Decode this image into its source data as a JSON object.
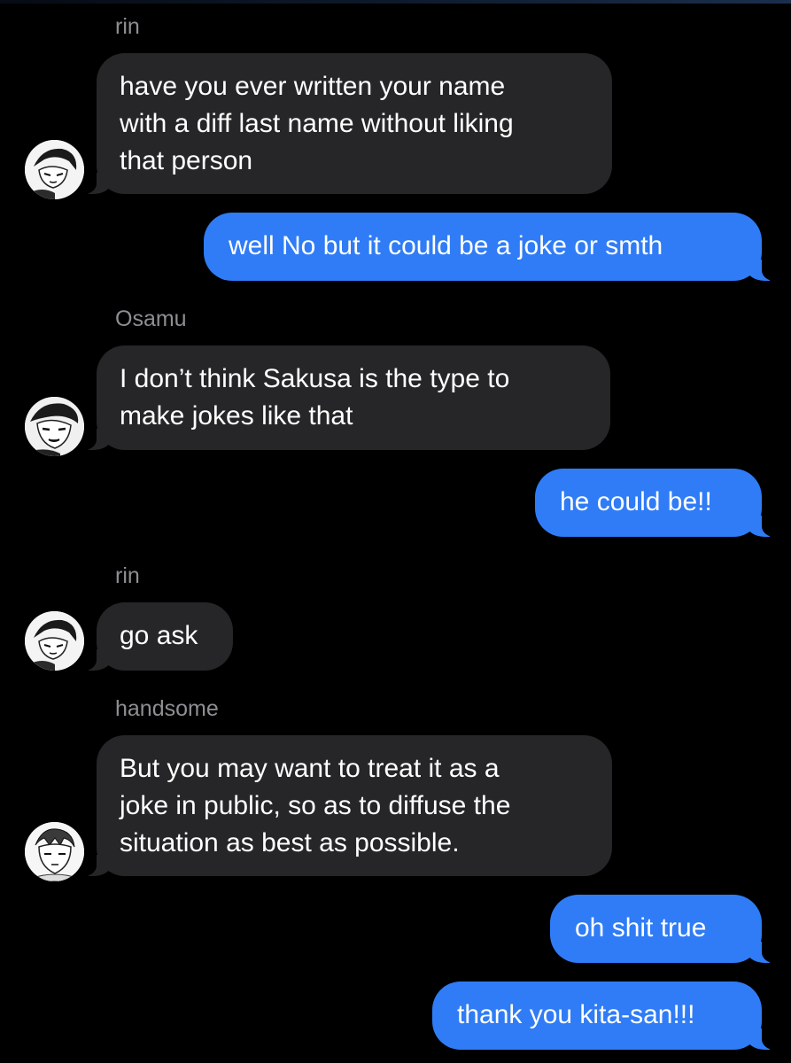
{
  "conversation": {
    "messages": [
      {
        "sender": "rin",
        "lines": [
          "have you ever written your name",
          "with a diff last name without liking",
          "that person"
        ],
        "avatar": "rin-avatar"
      },
      {
        "text": "well No but it could be a joke or smth"
      },
      {
        "sender": "Osamu",
        "lines": [
          "I don’t think Sakusa is the type to",
          "make jokes like that"
        ],
        "avatar": "osamu-avatar"
      },
      {
        "text": "he could be!!"
      },
      {
        "sender": "rin",
        "lines": [
          "go ask"
        ],
        "avatar": "rin-avatar"
      },
      {
        "sender": "handsome",
        "lines": [
          "But you may want to treat it as a",
          "joke in public, so as to diffuse the",
          "situation as best as possible."
        ],
        "avatar": "handsome-avatar"
      },
      {
        "text": "oh shit true"
      },
      {
        "text": "thank you kita-san!!!"
      }
    ]
  },
  "theme": {
    "background": "#000000",
    "incoming_bubble": "#262628",
    "outgoing_bubble": "#2f7cf6",
    "sender_label": "#8e8e93",
    "text": "#ffffff"
  }
}
